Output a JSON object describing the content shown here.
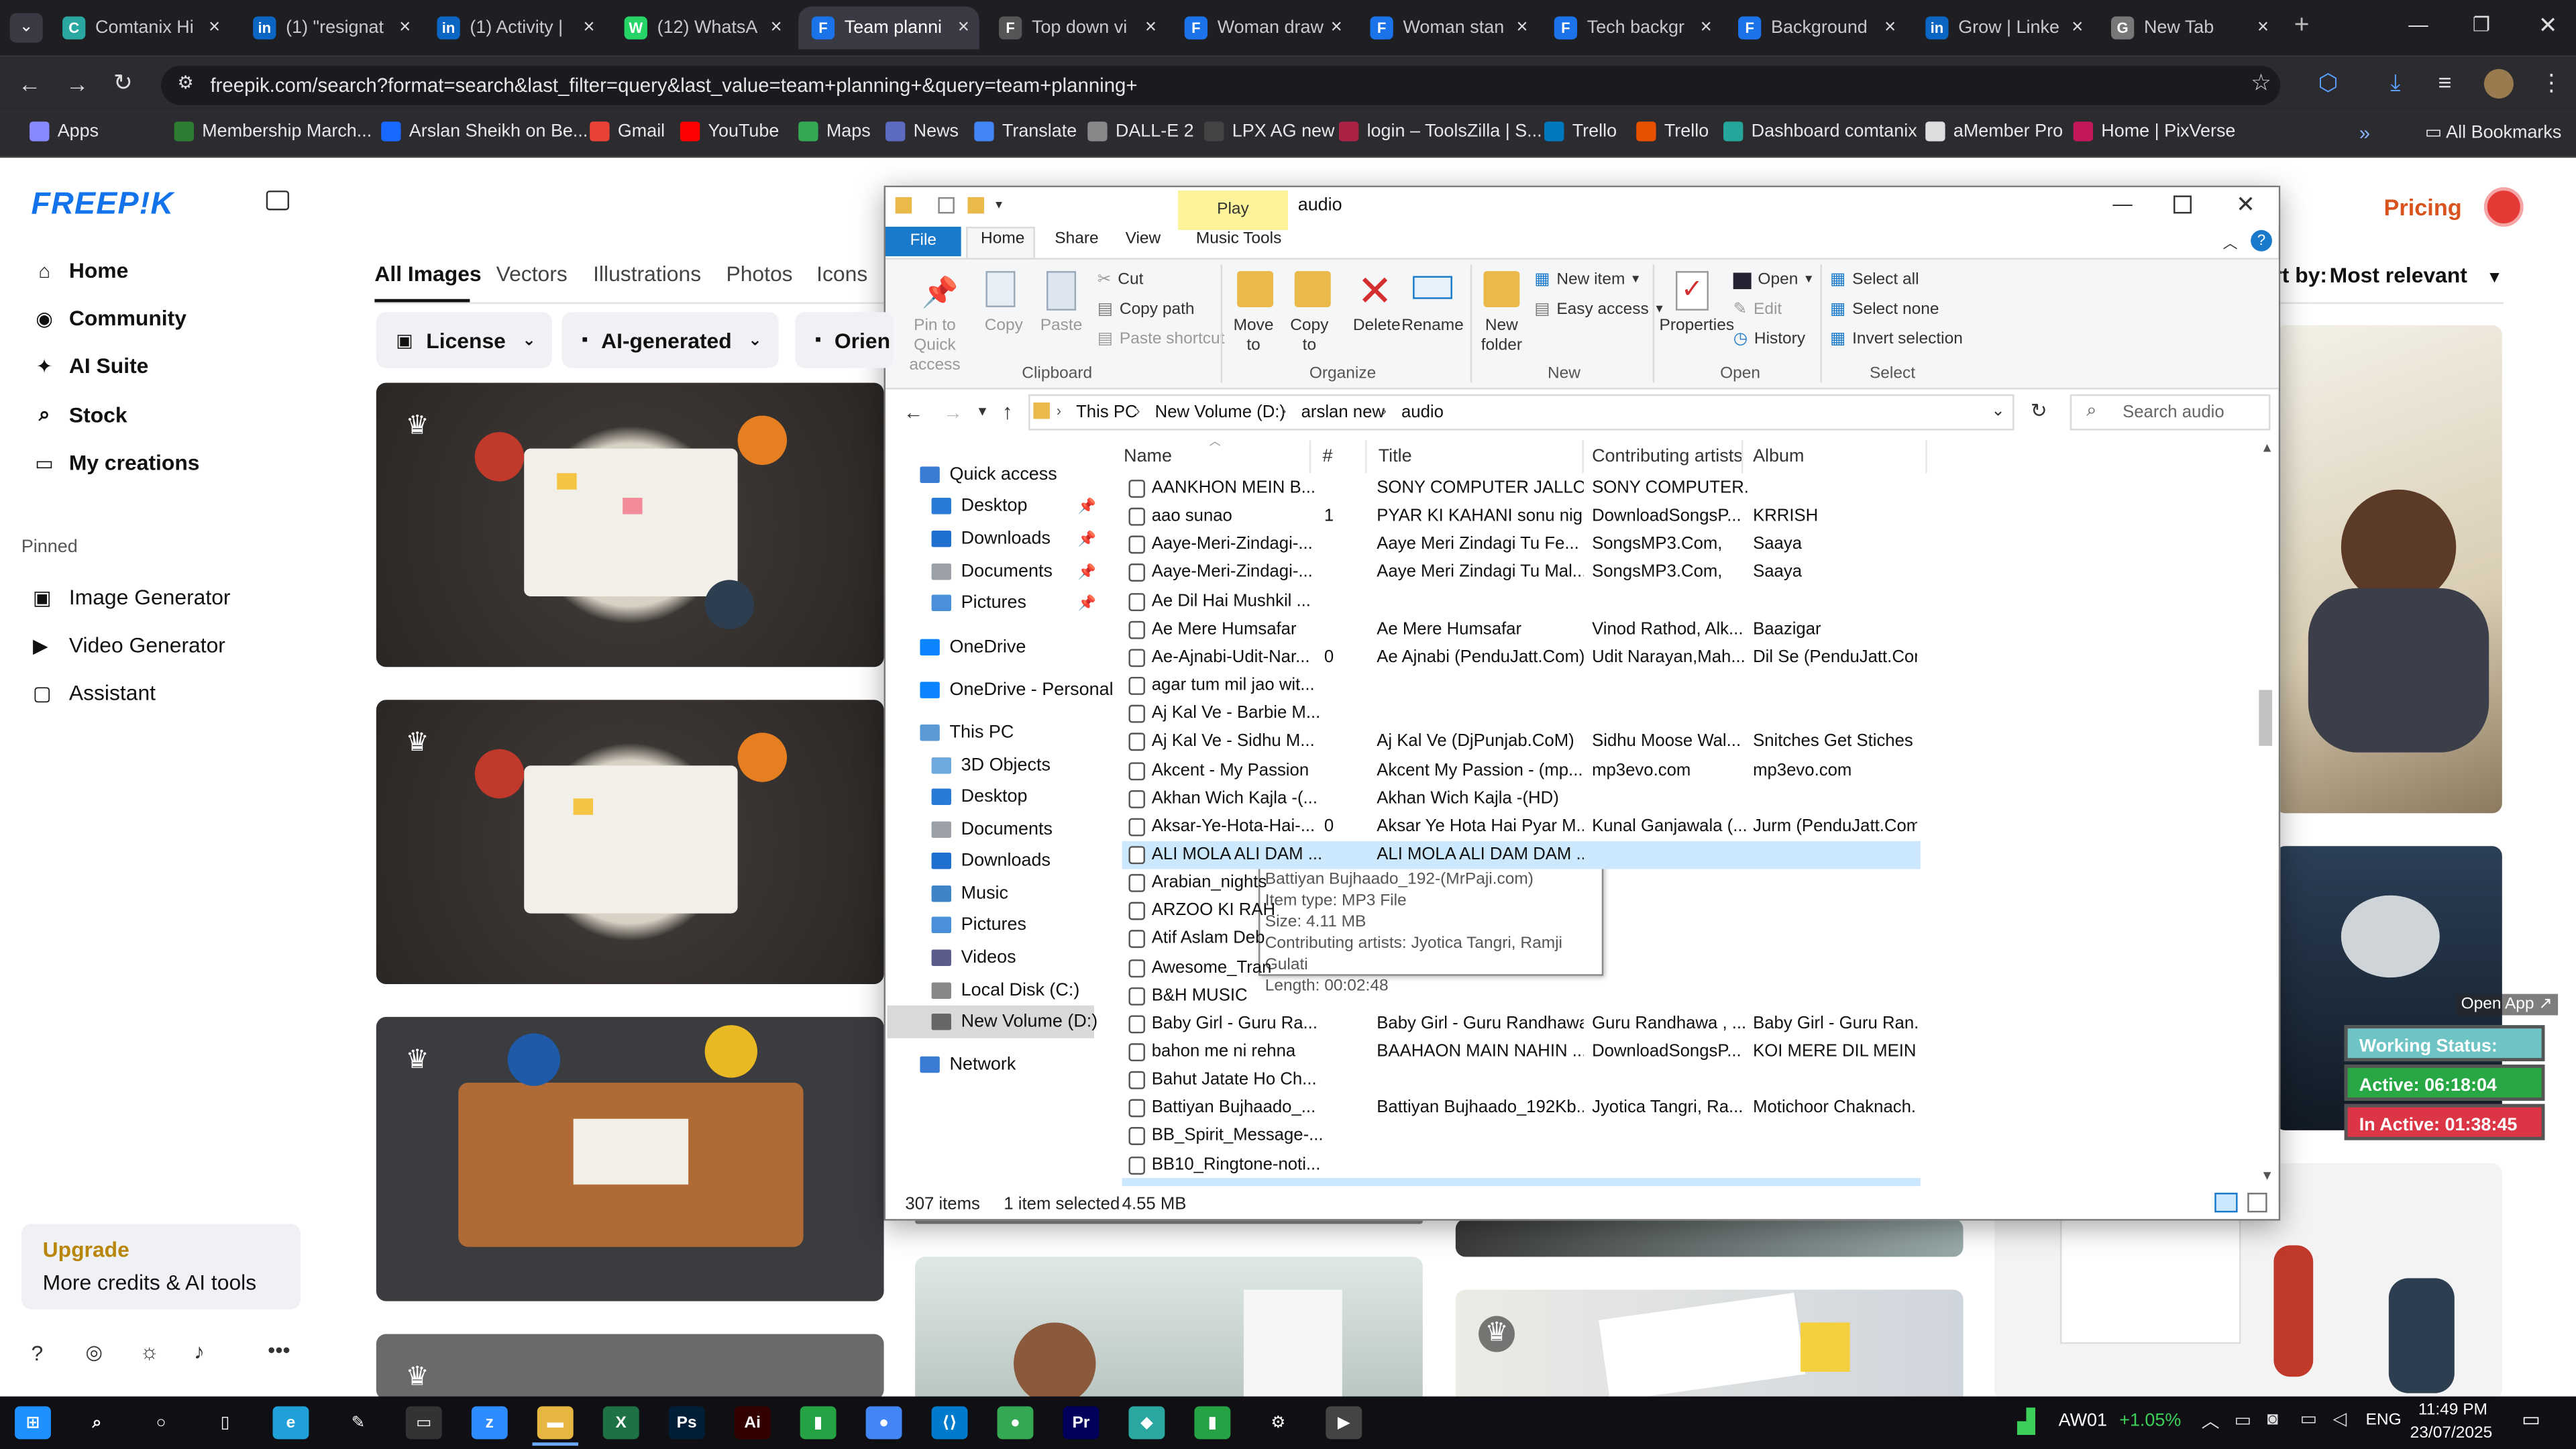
{
  "browser": {
    "tabs": [
      {
        "label": "Comtanix Hi",
        "color": "#2aa7a0",
        "glyph": "C"
      },
      {
        "label": "(1) \"resignat",
        "color": "#0a66c2",
        "glyph": "in"
      },
      {
        "label": "(1) Activity |",
        "color": "#0a66c2",
        "glyph": "in"
      },
      {
        "label": "(12) WhatsA",
        "color": "#25d366",
        "glyph": "W"
      },
      {
        "label": "Team planni",
        "color": "#1a73e8",
        "glyph": "F"
      },
      {
        "label": "Top down vi",
        "color": "#555555",
        "glyph": "F"
      },
      {
        "label": "Woman draw",
        "color": "#1a73e8",
        "glyph": "F"
      },
      {
        "label": "Woman stan",
        "color": "#1a73e8",
        "glyph": "F"
      },
      {
        "label": "Tech backgr",
        "color": "#1a73e8",
        "glyph": "F"
      },
      {
        "label": "Background",
        "color": "#1a73e8",
        "glyph": "F"
      },
      {
        "label": "Grow | Linke",
        "color": "#0a66c2",
        "glyph": "in"
      },
      {
        "label": "New Tab",
        "color": "#777777",
        "glyph": "G"
      }
    ],
    "url": "freepik.com/search?format=search&last_filter=query&last_value=team+planning+&query=team+planning+",
    "bookmarks": [
      {
        "label": "Apps",
        "color": "#8888ff"
      },
      {
        "label": "Membership March...",
        "color": "#2e7d32"
      },
      {
        "label": "Arslan Sheikh on Be...",
        "color": "#1769ff"
      },
      {
        "label": "Gmail",
        "color": "#ea4335"
      },
      {
        "label": "YouTube",
        "color": "#ff0000"
      },
      {
        "label": "Maps",
        "color": "#34a853"
      },
      {
        "label": "News",
        "color": "#5c6bc0"
      },
      {
        "label": "Translate",
        "color": "#4285f4"
      },
      {
        "label": "DALL-E 2",
        "color": "#888888"
      },
      {
        "label": "LPX AG new",
        "color": "#444444"
      },
      {
        "label": "login – ToolsZilla | S...",
        "color": "#aa2244"
      },
      {
        "label": "Trello",
        "color": "#0079bf"
      },
      {
        "label": "Trello",
        "color": "#e65100"
      },
      {
        "label": "Dashboard comtanix",
        "color": "#26a69a"
      },
      {
        "label": "aMember Pro",
        "color": "#dddddd"
      },
      {
        "label": "Home | PixVerse",
        "color": "#c2185b"
      }
    ],
    "all_bookmarks": "All Bookmarks"
  },
  "freepik": {
    "logo": "FREEP!K",
    "nav": [
      {
        "label": "Home",
        "icon": "home-icon",
        "glyph": "⌂"
      },
      {
        "label": "Community",
        "icon": "globe-icon",
        "glyph": "◉"
      },
      {
        "label": "AI Suite",
        "icon": "sparkle-icon",
        "glyph": "✦"
      },
      {
        "label": "Stock",
        "icon": "search-icon",
        "glyph": "⌕"
      },
      {
        "label": "My creations",
        "icon": "folder-icon",
        "glyph": "▭"
      }
    ],
    "pinned_title": "Pinned",
    "pinned": [
      {
        "label": "Image Generator",
        "glyph": "▣"
      },
      {
        "label": "Video Generator",
        "glyph": "▶"
      },
      {
        "label": "Assistant",
        "glyph": "▢"
      }
    ],
    "upgrade": {
      "title": "Upgrade",
      "sub": "More credits & AI tools"
    },
    "tabs": [
      "All Images",
      "Vectors",
      "Illustrations",
      "Photos",
      "Icons"
    ],
    "filters": [
      "License",
      "AI-generated",
      "Orien"
    ],
    "pricing": "Pricing",
    "sort_label": "rt by:",
    "sort_value": "Most relevant",
    "open_app": "Open App ↗"
  },
  "work_status": {
    "status": "Working Status: Active",
    "active": "Active: 06:18:04",
    "inactive": "In Active: 01:38:45"
  },
  "explorer": {
    "title": "audio",
    "play_tab": "Play",
    "ribbon_tabs": [
      "File",
      "Home",
      "Share",
      "View",
      "Music Tools"
    ],
    "clipboard": {
      "pin": "Pin to Quick access",
      "copy": "Copy",
      "paste": "Paste",
      "cut": "Cut",
      "copy_path": "Copy path",
      "paste_shortcut": "Paste shortcut",
      "group": "Clipboard"
    },
    "organize": {
      "move": "Move to",
      "copy": "Copy to",
      "delete": "Delete",
      "rename": "Rename",
      "group": "Organize"
    },
    "new": {
      "folder": "New folder",
      "item": "New item",
      "easy": "Easy access",
      "group": "New"
    },
    "open": {
      "props": "Properties",
      "open": "Open",
      "edit": "Edit",
      "history": "History",
      "group": "Open"
    },
    "select": {
      "all": "Select all",
      "none": "Select none",
      "invert": "Invert selection",
      "group": "Select"
    },
    "breadcrumb": [
      "This PC",
      "New Volume (D:)",
      "arslan new",
      "audio"
    ],
    "search_placeholder": "Search audio",
    "columns": {
      "name": "Name",
      "num": "#",
      "title": "Title",
      "artists": "Contributing artists",
      "album": "Album"
    },
    "tree": [
      {
        "label": "Quick access",
        "color": "#3a7bd5",
        "indent": 0,
        "pin": false
      },
      {
        "label": "Desktop",
        "color": "#2a7bd5",
        "indent": 1,
        "pin": true
      },
      {
        "label": "Downloads",
        "color": "#1e6fd0",
        "indent": 1,
        "pin": true
      },
      {
        "label": "Documents",
        "color": "#9aa0a6",
        "indent": 1,
        "pin": true
      },
      {
        "label": "Pictures",
        "color": "#4a90d9",
        "indent": 1,
        "pin": true
      },
      {
        "label": "OneDrive",
        "color": "#0a84ff",
        "indent": 0,
        "pin": false
      },
      {
        "label": "OneDrive - Personal",
        "color": "#0a84ff",
        "indent": 0,
        "pin": false
      },
      {
        "label": "This PC",
        "color": "#5a9bd5",
        "indent": 0,
        "pin": false
      },
      {
        "label": "3D Objects",
        "color": "#6fa8dc",
        "indent": 1,
        "pin": false
      },
      {
        "label": "Desktop",
        "color": "#2a7bd5",
        "indent": 1,
        "pin": false
      },
      {
        "label": "Documents",
        "color": "#9aa0a6",
        "indent": 1,
        "pin": false
      },
      {
        "label": "Downloads",
        "color": "#1e6fd0",
        "indent": 1,
        "pin": false
      },
      {
        "label": "Music",
        "color": "#3d85c6",
        "indent": 1,
        "pin": false
      },
      {
        "label": "Pictures",
        "color": "#4a90d9",
        "indent": 1,
        "pin": false
      },
      {
        "label": "Videos",
        "color": "#5b5b8c",
        "indent": 1,
        "pin": false
      },
      {
        "label": "Local Disk (C:)",
        "color": "#888888",
        "indent": 1,
        "pin": false
      },
      {
        "label": "New Volume (D:)",
        "color": "#666666",
        "indent": 1,
        "pin": false
      },
      {
        "label": "Network",
        "color": "#3a7bd5",
        "indent": 0,
        "pin": false
      }
    ],
    "files": [
      {
        "name": "AANKHON MEIN B...",
        "num": "",
        "title": "SONY COMPUTER JALLO ...",
        "artists": "SONY COMPUTER...",
        "album": ""
      },
      {
        "name": "aao sunao",
        "num": "1",
        "title": "PYAR KI KAHANI sonu nig...",
        "artists": "DownloadSongsP...",
        "album": "KRRISH"
      },
      {
        "name": "Aaye-Meri-Zindagi-...",
        "num": "",
        "title": "Aaye Meri Zindagi Tu Fe...",
        "artists": "SongsMP3.Com,",
        "album": "Saaya"
      },
      {
        "name": "Aaye-Meri-Zindagi-...",
        "num": "",
        "title": "Aaye Meri Zindagi Tu Mal...",
        "artists": "SongsMP3.Com,",
        "album": "Saaya"
      },
      {
        "name": "Ae Dil Hai Mushkil ...",
        "num": "",
        "title": "",
        "artists": "",
        "album": ""
      },
      {
        "name": "Ae Mere Humsafar",
        "num": "",
        "title": "Ae Mere Humsafar",
        "artists": "Vinod Rathod, Alk...",
        "album": "Baazigar"
      },
      {
        "name": "Ae-Ajnabi-Udit-Nar...",
        "num": "0",
        "title": "Ae Ajnabi (PenduJatt.Com)",
        "artists": "Udit Narayan,Mah...",
        "album": "Dil Se (PenduJatt.Com)"
      },
      {
        "name": "agar tum mil jao wit...",
        "num": "",
        "title": "",
        "artists": "",
        "album": ""
      },
      {
        "name": "Aj Kal Ve - Barbie M...",
        "num": "",
        "title": "",
        "artists": "",
        "album": ""
      },
      {
        "name": "Aj Kal Ve - Sidhu M...",
        "num": "",
        "title": "Aj Kal Ve (DjPunjab.CoM)",
        "artists": "Sidhu Moose Wal...",
        "album": "Snitches Get Stiches (..."
      },
      {
        "name": "Akcent - My Passion",
        "num": "",
        "title": "Akcent My Passion - (mp...",
        "artists": "mp3evo.com",
        "album": "mp3evo.com"
      },
      {
        "name": "Akhan Wich Kajla -(...",
        "num": "",
        "title": "Akhan Wich Kajla -(HD)",
        "artists": "",
        "album": ""
      },
      {
        "name": "Aksar-Ye-Hota-Hai-...",
        "num": "0",
        "title": "Aksar Ye Hota Hai Pyar M...",
        "artists": "Kunal Ganjawala (...",
        "album": "Jurm (PenduJatt.Com)"
      },
      {
        "name": "ALI MOLA ALI DAM ...",
        "num": "",
        "title": "ALI MOLA ALI DAM DAM ...",
        "artists": "",
        "album": ""
      },
      {
        "name": "Arabian_nights",
        "num": "",
        "title": "",
        "artists": "",
        "album": ""
      },
      {
        "name": "ARZOO KI RAH",
        "num": "",
        "title": "",
        "artists": "",
        "album": ""
      },
      {
        "name": "Atif Aslam Deb",
        "num": "",
        "title": "",
        "artists": "",
        "album": ""
      },
      {
        "name": "Awesome_Tran",
        "num": "",
        "title": "",
        "artists": "",
        "album": ""
      },
      {
        "name": "B&H MUSIC",
        "num": "",
        "title": "",
        "artists": "",
        "album": ""
      },
      {
        "name": "Baby Girl - Guru Ra...",
        "num": "",
        "title": "Baby Girl - Guru Randhawa",
        "artists": "Guru Randhawa , ...",
        "album": "Baby Girl - Guru Ran..."
      },
      {
        "name": "bahon me ni rehna",
        "num": "",
        "title": "BAAHAON MAIN NAHIN ...",
        "artists": "DownloadSongsP...",
        "album": "KOI MERE DIL MEIN ..."
      },
      {
        "name": "Bahut Jatate Ho Ch...",
        "num": "",
        "title": "",
        "artists": "",
        "album": ""
      },
      {
        "name": "Battiyan Bujhaado_...",
        "num": "",
        "title": "Battiyan Bujhaado_192Kb...",
        "artists": "Jyotica Tangri, Ra...",
        "album": "Motichoor Chaknach..."
      },
      {
        "name": "BB_Spirit_Message-...",
        "num": "",
        "title": "",
        "artists": "",
        "album": ""
      },
      {
        "name": "BB10_Ringtone-noti...",
        "num": "",
        "title": "",
        "artists": "",
        "album": ""
      }
    ],
    "tooltip": [
      "Battiyan Bujhaado_192-(MrPaji.com)",
      "Item type: MP3 File",
      "Size: 4.11 MB",
      "Contributing artists: Jyotica Tangri, Ramji Gulati",
      "Length: 00:02:48"
    ],
    "status": {
      "items": "307 items",
      "selected": "1 item selected",
      "size": "4.55 MB"
    }
  },
  "taskbar": {
    "icons": [
      {
        "name": "start-icon",
        "color": "#1e90ff",
        "glyph": "⊞"
      },
      {
        "name": "search-icon",
        "color": "#101014",
        "glyph": "⌕"
      },
      {
        "name": "cortana-icon",
        "color": "#101014",
        "glyph": "○"
      },
      {
        "name": "task-view-icon",
        "color": "#101014",
        "glyph": "▯"
      },
      {
        "name": "edge-icon",
        "color": "#1fa0d8",
        "glyph": "e"
      },
      {
        "name": "pen-icon",
        "color": "#101014",
        "glyph": "✎"
      },
      {
        "name": "terminal-icon",
        "color": "#333333",
        "glyph": "▭"
      },
      {
        "name": "zoom-icon",
        "color": "#2d8cff",
        "glyph": "z"
      },
      {
        "name": "file-explorer-icon",
        "color": "#e5b742",
        "glyph": "▬"
      },
      {
        "name": "excel-icon",
        "color": "#1e7145",
        "glyph": "X"
      },
      {
        "name": "photoshop-icon",
        "color": "#001e36",
        "glyph": "Ps"
      },
      {
        "name": "illustrator-icon",
        "color": "#330000",
        "glyph": "Ai"
      },
      {
        "name": "app-green-icon",
        "color": "#25a244",
        "glyph": "▮"
      },
      {
        "name": "chrome-icon",
        "color": "#4285f4",
        "glyph": "●"
      },
      {
        "name": "vscode-icon",
        "color": "#007acc",
        "glyph": "⟨⟩"
      },
      {
        "name": "chrome-profile-icon",
        "color": "#34a853",
        "glyph": "●"
      },
      {
        "name": "premiere-icon",
        "color": "#00005b",
        "glyph": "Pr"
      },
      {
        "name": "app-teal-icon",
        "color": "#2aa7a0",
        "glyph": "◆"
      },
      {
        "name": "app-green2-icon",
        "color": "#25a244",
        "glyph": "▮"
      },
      {
        "name": "settings-icon",
        "color": "#101014",
        "glyph": "⚙"
      },
      {
        "name": "media-player-icon",
        "color": "#444444",
        "glyph": "▶"
      }
    ],
    "stock": "AW01",
    "stock_change": "+1.05%",
    "lang": "ENG",
    "time": "11:49 PM",
    "date": "23/07/2025"
  }
}
